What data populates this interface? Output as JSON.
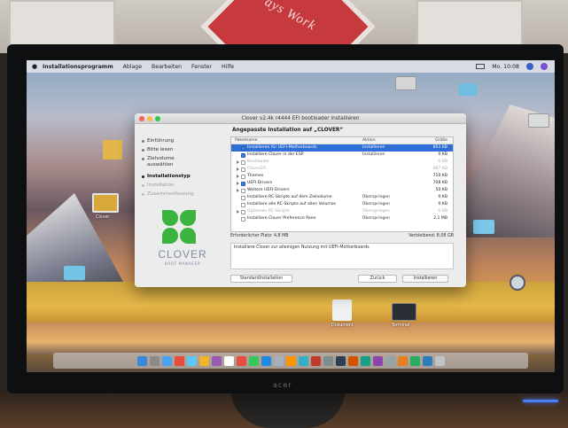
{
  "sign_text": "ays Work",
  "monitor_brand": "acer",
  "menubar": {
    "app_name": "Installationsprogramm",
    "items": [
      "Ablage",
      "Bearbeiten",
      "Fenster",
      "Hilfe"
    ],
    "clock": "Mo. 10:08"
  },
  "window": {
    "title": "Clover v2.4k r4444 EFI bootloader installieren",
    "steps": [
      {
        "label": "Einführung",
        "state": "done"
      },
      {
        "label": "Bitte lesen",
        "state": "done"
      },
      {
        "label": "Zielvolume auswählen",
        "state": "done"
      },
      {
        "label": "Installationstyp",
        "state": "active"
      },
      {
        "label": "Installation",
        "state": "pending"
      },
      {
        "label": "Zusammenfassung",
        "state": "pending"
      }
    ],
    "logo_text": "CLOVER",
    "logo_subtitle": "BOOT MANAGER",
    "heading": "Angepasste Installation auf „CLOVER“",
    "columns": {
      "name": "Paketname",
      "action": "Aktion",
      "size": "Größe"
    },
    "packages": [
      {
        "name": "Installieren für UEFI-Motherboards",
        "action": "Installieren",
        "size": "853 KB",
        "checked": true,
        "selected": true,
        "dim": false,
        "expander": false
      },
      {
        "name": "Installiere Clover in der ESP",
        "action": "Installieren",
        "size": "0 KB",
        "checked": true,
        "selected": false,
        "dim": false,
        "expander": false
      },
      {
        "name": "Bootloader",
        "action": "",
        "size": "0 KB",
        "checked": false,
        "selected": false,
        "dim": true,
        "expander": true
      },
      {
        "name": "CloverEFI",
        "action": "",
        "size": "987 KB",
        "checked": false,
        "selected": false,
        "dim": true,
        "expander": true
      },
      {
        "name": "Themes",
        "action": "",
        "size": "710 KB",
        "checked": false,
        "selected": false,
        "dim": false,
        "expander": true
      },
      {
        "name": "UEFI Drivers",
        "action": "",
        "size": "708 KB",
        "checked": true,
        "selected": false,
        "dim": false,
        "expander": true
      },
      {
        "name": "Weitere UEFI-Drivers",
        "action": "",
        "size": "50 KB",
        "checked": false,
        "selected": false,
        "dim": false,
        "expander": true
      },
      {
        "name": "Installiere RC-Skripte auf dem Zielvolume",
        "action": "Überspringen",
        "size": "0 KB",
        "checked": false,
        "selected": false,
        "dim": false,
        "expander": false
      },
      {
        "name": "Installiere alle RC-Skripte auf allen Volumes",
        "action": "Überspringen",
        "size": "0 KB",
        "checked": false,
        "selected": false,
        "dim": false,
        "expander": false
      },
      {
        "name": "Optionale RC-Skripte",
        "action": "Überspringen",
        "size": "0 KB",
        "checked": false,
        "selected": false,
        "dim": true,
        "expander": true
      },
      {
        "name": "Installiere Clover Preference Pane",
        "action": "Überspringen",
        "size": "2,1 MB",
        "checked": false,
        "selected": false,
        "dim": false,
        "expander": false
      }
    ],
    "space_required": "Erforderlicher Platz:  4,8 MB",
    "space_remaining": "Verbleibend:  8,08 GB",
    "description": "Installiere Clover zur alleinigen Nutzung mit UEFI-Motherboards",
    "buttons": {
      "standard": "Standardinstallation",
      "back": "Zurück",
      "install": "Installieren"
    }
  },
  "desktop_icons": [
    "Clover",
    "Dokument",
    "Bildschirmfoto",
    "Terminal"
  ],
  "colors": {
    "accent": "#2f6ed6",
    "clover_green": "#3bb33f",
    "sign_red": "#c63a3d"
  }
}
